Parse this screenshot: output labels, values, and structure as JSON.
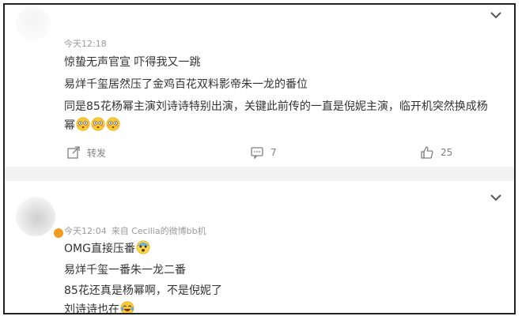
{
  "comment1": {
    "time": "今天12:18",
    "lines": [
      "惊蛰无声官宣 吓得我又一跳",
      "易烊千玺居然压了金鸡百花双料影帝朱一龙的番位",
      "同是85花杨幂主演刘诗诗特别出演，关键此前传的一直是倪妮主演，临开机突然换成杨",
      "幂"
    ],
    "emojis": [
      "flushed-face",
      "flushed-face",
      "flushed-face"
    ],
    "share_label": "转发",
    "comment_count": "7",
    "like_count": "25"
  },
  "comment2": {
    "time": "今天12:04",
    "source": "来自 Cecilia的微博bb机",
    "lines": [
      "OMG直接压番",
      "易烊千玺一番朱一龙二番",
      "85花还真是杨幂啊，不是倪妮了",
      "刘诗诗也在"
    ],
    "emojis": [
      "surprised-face",
      "laughing-tears-face"
    ]
  },
  "colors": {
    "text": "#333333",
    "meta": "#9a9a9a",
    "action": "#808080",
    "separator": "#f2f2f2",
    "verified_badge": "#f29c1f"
  }
}
